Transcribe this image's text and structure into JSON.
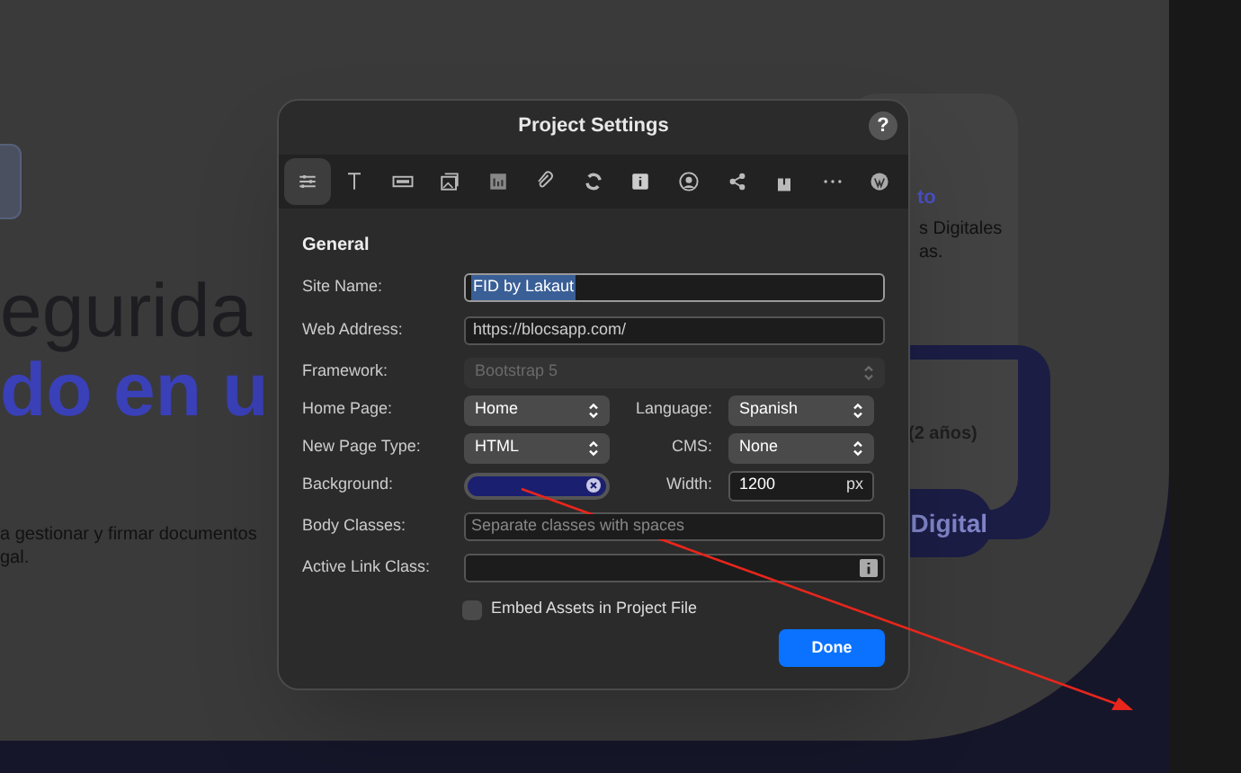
{
  "background_page": {
    "heading_light": "egurida",
    "heading_bold": "do en u",
    "paragraph_lines": [
      "a gestionar y firmar documentos",
      "gal."
    ],
    "card_title": "to",
    "card_text_lines": [
      "s Digitales",
      "as."
    ],
    "plan_text": "(2 años)",
    "cta_text": "Digital"
  },
  "dialog": {
    "title": "Project Settings",
    "help": "?",
    "toolbar": [
      {
        "selected": true
      },
      {
        "selected": false
      },
      {
        "selected": false
      },
      {
        "selected": false
      },
      {
        "selected": false
      },
      {
        "selected": false
      },
      {
        "selected": false
      },
      {
        "selected": false
      },
      {
        "selected": false
      },
      {
        "selected": false
      },
      {
        "selected": false
      },
      {
        "selected": false
      },
      {
        "selected": false
      }
    ],
    "section": "General",
    "rows": [
      {
        "items": [
          {
            "label": "Site Name:",
            "kind": "text",
            "value": "FID by Lakaut",
            "highlighted": true
          }
        ]
      },
      {
        "items": [
          {
            "label": "Web Address:",
            "kind": "text",
            "value": "https://blocsapp.com/"
          }
        ]
      },
      {
        "items": [
          {
            "label": "Framework:",
            "kind": "select",
            "value": "Bootstrap 5",
            "disabled": true
          }
        ]
      },
      {
        "items": [
          {
            "label": "Home Page:",
            "kind": "select",
            "value": "Home",
            "disabled": false
          },
          {
            "label": "Language:",
            "kind": "select",
            "value": "Spanish",
            "disabled": false
          }
        ]
      },
      {
        "items": [
          {
            "label": "New Page Type:",
            "kind": "select",
            "value": "HTML",
            "disabled": false
          },
          {
            "label": "CMS:",
            "kind": "select",
            "value": "None",
            "disabled": false
          }
        ]
      },
      {
        "items": [
          {
            "label": "Background:",
            "kind": "color",
            "color": "#1b1f70"
          },
          {
            "label": "Width:",
            "kind": "number",
            "value": "1200",
            "unit": "px"
          }
        ]
      },
      {
        "items": [
          {
            "label": "Body Classes:",
            "kind": "text",
            "placeholder": "Separate classes with spaces"
          }
        ]
      },
      {
        "items": [
          {
            "label": "Active Link Class:",
            "kind": "text",
            "info": true
          }
        ]
      }
    ],
    "checkbox": {
      "label": "Embed Assets in Project File",
      "checked": false
    },
    "done": "Done"
  }
}
